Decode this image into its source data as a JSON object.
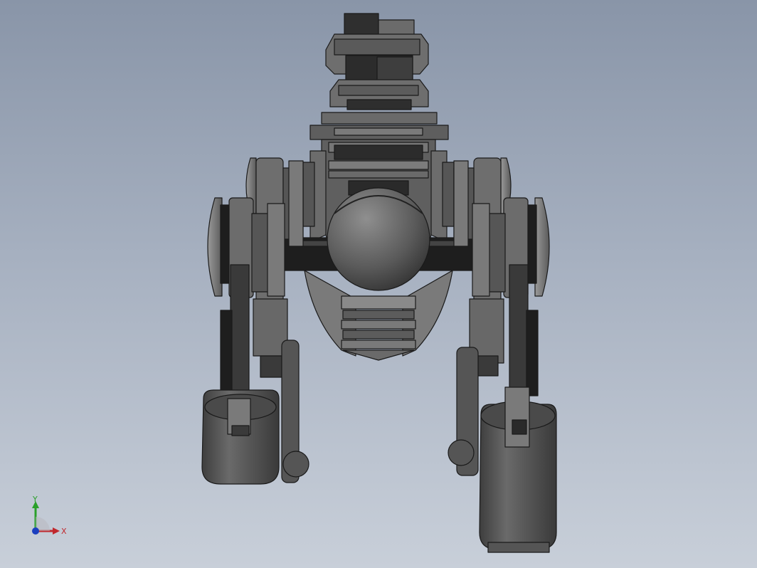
{
  "viewport": {
    "background_top": "#8995a8",
    "background_bottom": "#c8cfd9"
  },
  "model": {
    "body_color": "#5e5e5e",
    "edge_color": "#1a1a1a",
    "highlight_color": "#8a8a8a"
  },
  "triad": {
    "x_label": "X",
    "y_label": "Y",
    "x_color": "#c0282d",
    "y_color": "#2aa02a",
    "z_color": "#1b3fbf"
  }
}
